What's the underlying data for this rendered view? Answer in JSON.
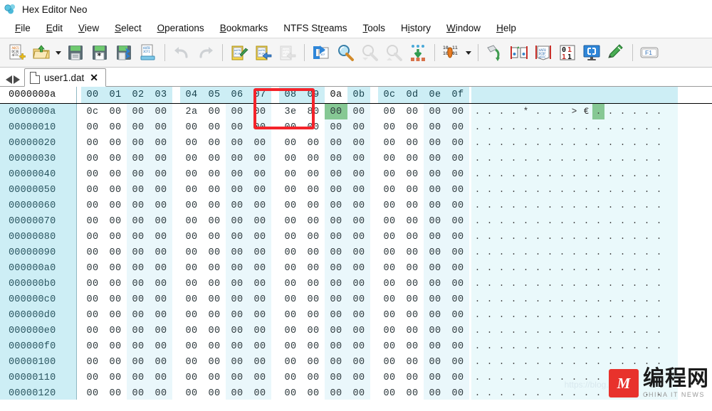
{
  "window": {
    "title": "Hex Editor Neo",
    "icon": "hex-editor-neo-logo"
  },
  "menubar": {
    "items": [
      {
        "label": "File",
        "accel": "F"
      },
      {
        "label": "Edit",
        "accel": "E"
      },
      {
        "label": "View",
        "accel": "V"
      },
      {
        "label": "Select",
        "accel": "S"
      },
      {
        "label": "Operations",
        "accel": "O"
      },
      {
        "label": "Bookmarks",
        "accel": "B"
      },
      {
        "label": "NTFS Streams",
        "accel": "r"
      },
      {
        "label": "Tools",
        "accel": "T"
      },
      {
        "label": "History",
        "accel": "i"
      },
      {
        "label": "Window",
        "accel": "W"
      },
      {
        "label": "Help",
        "accel": "H"
      }
    ]
  },
  "toolbar": {
    "buttons": [
      {
        "name": "new-file-icon",
        "enabled": true
      },
      {
        "name": "open-file-icon",
        "enabled": true,
        "dropdown": true
      },
      {
        "name": "save-icon",
        "enabled": true
      },
      {
        "name": "save-all-icon",
        "enabled": true
      },
      {
        "name": "save-as-icon",
        "enabled": true
      },
      {
        "name": "save-selection-icon",
        "enabled": true
      },
      {
        "name": "undo-icon",
        "enabled": false
      },
      {
        "name": "redo-icon",
        "enabled": false
      },
      {
        "name": "cut-icon",
        "enabled": true
      },
      {
        "name": "copy-icon",
        "enabled": true
      },
      {
        "name": "paste-icon",
        "enabled": false
      },
      {
        "name": "goto-icon",
        "enabled": true
      },
      {
        "name": "find-icon",
        "enabled": true
      },
      {
        "name": "find-next-icon",
        "enabled": false
      },
      {
        "name": "find-previous-icon",
        "enabled": false
      },
      {
        "name": "replace-icon",
        "enabled": true
      },
      {
        "name": "data-inspector-icon",
        "enabled": true,
        "dropdown": true
      },
      {
        "name": "fill-icon",
        "enabled": true
      },
      {
        "name": "compare-icon",
        "enabled": true
      },
      {
        "name": "file-info-icon",
        "enabled": true
      },
      {
        "name": "binary-mode-icon",
        "enabled": true
      },
      {
        "name": "fullscreen-icon",
        "enabled": true
      },
      {
        "name": "customize-icon",
        "enabled": true
      },
      {
        "name": "help-f1-icon",
        "enabled": true
      }
    ]
  },
  "tabstrip": {
    "nav_prev": "prev-tab-arrow",
    "nav_next": "next-tab-arrow",
    "tabs": [
      {
        "label": "user1.dat",
        "active": true,
        "close": "✕"
      }
    ]
  },
  "hexview": {
    "header": {
      "offset_label": "0000000a",
      "columns": [
        "00",
        "01",
        "02",
        "03",
        "04",
        "05",
        "06",
        "07",
        "08",
        "09",
        "0a",
        "0b",
        "0c",
        "0d",
        "0e",
        "0f"
      ],
      "current_column": "0a"
    },
    "selection": {
      "offset_index": 10,
      "highlight_color": "#86c894"
    },
    "annotation": {
      "type": "red-rectangle",
      "color": "#f4232a",
      "covers_columns": [
        "08",
        "09"
      ]
    },
    "rows": [
      {
        "offset": "0000000a",
        "bytes": [
          "0c",
          "00",
          "00",
          "00",
          "2a",
          "00",
          "00",
          "00",
          "3e",
          "80",
          "00",
          "00",
          "00",
          "00",
          "00",
          "00"
        ],
        "ascii": [
          ".",
          ".",
          ".",
          ".",
          "*",
          ".",
          ".",
          ".",
          ">",
          "€",
          ".",
          ".",
          ".",
          ".",
          ".",
          "."
        ]
      },
      {
        "offset": "00000010",
        "bytes": [
          "00",
          "00",
          "00",
          "00",
          "00",
          "00",
          "00",
          "00",
          "00",
          "00",
          "00",
          "00",
          "00",
          "00",
          "00",
          "00"
        ],
        "ascii": [
          ".",
          ".",
          ".",
          ".",
          ".",
          ".",
          ".",
          ".",
          ".",
          ".",
          ".",
          ".",
          ".",
          ".",
          ".",
          "."
        ]
      },
      {
        "offset": "00000020",
        "bytes": [
          "00",
          "00",
          "00",
          "00",
          "00",
          "00",
          "00",
          "00",
          "00",
          "00",
          "00",
          "00",
          "00",
          "00",
          "00",
          "00"
        ],
        "ascii": [
          ".",
          ".",
          ".",
          ".",
          ".",
          ".",
          ".",
          ".",
          ".",
          ".",
          ".",
          ".",
          ".",
          ".",
          ".",
          "."
        ]
      },
      {
        "offset": "00000030",
        "bytes": [
          "00",
          "00",
          "00",
          "00",
          "00",
          "00",
          "00",
          "00",
          "00",
          "00",
          "00",
          "00",
          "00",
          "00",
          "00",
          "00"
        ],
        "ascii": [
          ".",
          ".",
          ".",
          ".",
          ".",
          ".",
          ".",
          ".",
          ".",
          ".",
          ".",
          ".",
          ".",
          ".",
          ".",
          "."
        ]
      },
      {
        "offset": "00000040",
        "bytes": [
          "00",
          "00",
          "00",
          "00",
          "00",
          "00",
          "00",
          "00",
          "00",
          "00",
          "00",
          "00",
          "00",
          "00",
          "00",
          "00"
        ],
        "ascii": [
          ".",
          ".",
          ".",
          ".",
          ".",
          ".",
          ".",
          ".",
          ".",
          ".",
          ".",
          ".",
          ".",
          ".",
          ".",
          "."
        ]
      },
      {
        "offset": "00000050",
        "bytes": [
          "00",
          "00",
          "00",
          "00",
          "00",
          "00",
          "00",
          "00",
          "00",
          "00",
          "00",
          "00",
          "00",
          "00",
          "00",
          "00"
        ],
        "ascii": [
          ".",
          ".",
          ".",
          ".",
          ".",
          ".",
          ".",
          ".",
          ".",
          ".",
          ".",
          ".",
          ".",
          ".",
          ".",
          "."
        ]
      },
      {
        "offset": "00000060",
        "bytes": [
          "00",
          "00",
          "00",
          "00",
          "00",
          "00",
          "00",
          "00",
          "00",
          "00",
          "00",
          "00",
          "00",
          "00",
          "00",
          "00"
        ],
        "ascii": [
          ".",
          ".",
          ".",
          ".",
          ".",
          ".",
          ".",
          ".",
          ".",
          ".",
          ".",
          ".",
          ".",
          ".",
          ".",
          "."
        ]
      },
      {
        "offset": "00000070",
        "bytes": [
          "00",
          "00",
          "00",
          "00",
          "00",
          "00",
          "00",
          "00",
          "00",
          "00",
          "00",
          "00",
          "00",
          "00",
          "00",
          "00"
        ],
        "ascii": [
          ".",
          ".",
          ".",
          ".",
          ".",
          ".",
          ".",
          ".",
          ".",
          ".",
          ".",
          ".",
          ".",
          ".",
          ".",
          "."
        ]
      },
      {
        "offset": "00000080",
        "bytes": [
          "00",
          "00",
          "00",
          "00",
          "00",
          "00",
          "00",
          "00",
          "00",
          "00",
          "00",
          "00",
          "00",
          "00",
          "00",
          "00"
        ],
        "ascii": [
          ".",
          ".",
          ".",
          ".",
          ".",
          ".",
          ".",
          ".",
          ".",
          ".",
          ".",
          ".",
          ".",
          ".",
          ".",
          "."
        ]
      },
      {
        "offset": "00000090",
        "bytes": [
          "00",
          "00",
          "00",
          "00",
          "00",
          "00",
          "00",
          "00",
          "00",
          "00",
          "00",
          "00",
          "00",
          "00",
          "00",
          "00"
        ],
        "ascii": [
          ".",
          ".",
          ".",
          ".",
          ".",
          ".",
          ".",
          ".",
          ".",
          ".",
          ".",
          ".",
          ".",
          ".",
          ".",
          "."
        ]
      },
      {
        "offset": "000000a0",
        "bytes": [
          "00",
          "00",
          "00",
          "00",
          "00",
          "00",
          "00",
          "00",
          "00",
          "00",
          "00",
          "00",
          "00",
          "00",
          "00",
          "00"
        ],
        "ascii": [
          ".",
          ".",
          ".",
          ".",
          ".",
          ".",
          ".",
          ".",
          ".",
          ".",
          ".",
          ".",
          ".",
          ".",
          ".",
          "."
        ]
      },
      {
        "offset": "000000b0",
        "bytes": [
          "00",
          "00",
          "00",
          "00",
          "00",
          "00",
          "00",
          "00",
          "00",
          "00",
          "00",
          "00",
          "00",
          "00",
          "00",
          "00"
        ],
        "ascii": [
          ".",
          ".",
          ".",
          ".",
          ".",
          ".",
          ".",
          ".",
          ".",
          ".",
          ".",
          ".",
          ".",
          ".",
          ".",
          "."
        ]
      },
      {
        "offset": "000000c0",
        "bytes": [
          "00",
          "00",
          "00",
          "00",
          "00",
          "00",
          "00",
          "00",
          "00",
          "00",
          "00",
          "00",
          "00",
          "00",
          "00",
          "00"
        ],
        "ascii": [
          ".",
          ".",
          ".",
          ".",
          ".",
          ".",
          ".",
          ".",
          ".",
          ".",
          ".",
          ".",
          ".",
          ".",
          ".",
          "."
        ]
      },
      {
        "offset": "000000d0",
        "bytes": [
          "00",
          "00",
          "00",
          "00",
          "00",
          "00",
          "00",
          "00",
          "00",
          "00",
          "00",
          "00",
          "00",
          "00",
          "00",
          "00"
        ],
        "ascii": [
          ".",
          ".",
          ".",
          ".",
          ".",
          ".",
          ".",
          ".",
          ".",
          ".",
          ".",
          ".",
          ".",
          ".",
          ".",
          "."
        ]
      },
      {
        "offset": "000000e0",
        "bytes": [
          "00",
          "00",
          "00",
          "00",
          "00",
          "00",
          "00",
          "00",
          "00",
          "00",
          "00",
          "00",
          "00",
          "00",
          "00",
          "00"
        ],
        "ascii": [
          ".",
          ".",
          ".",
          ".",
          ".",
          ".",
          ".",
          ".",
          ".",
          ".",
          ".",
          ".",
          ".",
          ".",
          ".",
          "."
        ]
      },
      {
        "offset": "000000f0",
        "bytes": [
          "00",
          "00",
          "00",
          "00",
          "00",
          "00",
          "00",
          "00",
          "00",
          "00",
          "00",
          "00",
          "00",
          "00",
          "00",
          "00"
        ],
        "ascii": [
          ".",
          ".",
          ".",
          ".",
          ".",
          ".",
          ".",
          ".",
          ".",
          ".",
          ".",
          ".",
          ".",
          ".",
          ".",
          "."
        ]
      },
      {
        "offset": "00000100",
        "bytes": [
          "00",
          "00",
          "00",
          "00",
          "00",
          "00",
          "00",
          "00",
          "00",
          "00",
          "00",
          "00",
          "00",
          "00",
          "00",
          "00"
        ],
        "ascii": [
          ".",
          ".",
          ".",
          ".",
          ".",
          ".",
          ".",
          ".",
          ".",
          ".",
          ".",
          ".",
          ".",
          ".",
          ".",
          "."
        ]
      },
      {
        "offset": "00000110",
        "bytes": [
          "00",
          "00",
          "00",
          "00",
          "00",
          "00",
          "00",
          "00",
          "00",
          "00",
          "00",
          "00",
          "00",
          "00",
          "00",
          "00"
        ],
        "ascii": [
          ".",
          ".",
          ".",
          ".",
          ".",
          ".",
          ".",
          ".",
          ".",
          ".",
          ".",
          ".",
          ".",
          ".",
          ".",
          "."
        ]
      },
      {
        "offset": "00000120",
        "bytes": [
          "00",
          "00",
          "00",
          "00",
          "00",
          "00",
          "00",
          "00",
          "00",
          "00",
          "00",
          "00",
          "00",
          "00",
          "00",
          "00"
        ],
        "ascii": [
          ".",
          ".",
          ".",
          ".",
          ".",
          ".",
          ".",
          ".",
          ".",
          ".",
          ".",
          ".",
          ".",
          ".",
          ".",
          "."
        ]
      }
    ]
  },
  "watermark": {
    "logo_text": "M",
    "cn": "编程网",
    "en": "CHINA  IT  NEWS",
    "url": "https://blog.csdn"
  }
}
